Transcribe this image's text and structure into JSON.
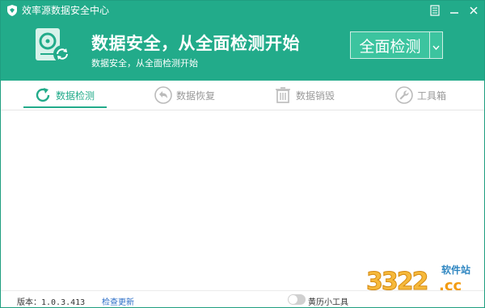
{
  "window": {
    "title": "效率源数据安全中心"
  },
  "titlebar_buttons": [
    {
      "icon": "menu-icon"
    },
    {
      "icon": "minimize-icon"
    },
    {
      "icon": "close-icon"
    }
  ],
  "hero": {
    "title": "数据安全，从全面检测开始",
    "subtitle": "数据安全，从全面检测开始",
    "scan_button_label": "全面检测"
  },
  "tabs": [
    {
      "label": "数据检测",
      "icon": "refresh-scan-icon",
      "active": true
    },
    {
      "label": "数据恢复",
      "icon": "restore-arrow-icon",
      "active": false
    },
    {
      "label": "数据销毁",
      "icon": "trash-icon",
      "active": false
    },
    {
      "label": "工具箱",
      "icon": "wrench-icon",
      "active": false
    }
  ],
  "statusbar": {
    "version": "版本：1.0.3.413",
    "check_update": "检查更新",
    "toggle_label": "黄历小工具"
  },
  "watermark": {
    "number": "3322",
    "site_label": "软件站",
    "domain": ".cc"
  },
  "colors": {
    "brand": "#22ab8a",
    "button": "#3cc49f",
    "tab_inactive": "#999999"
  }
}
